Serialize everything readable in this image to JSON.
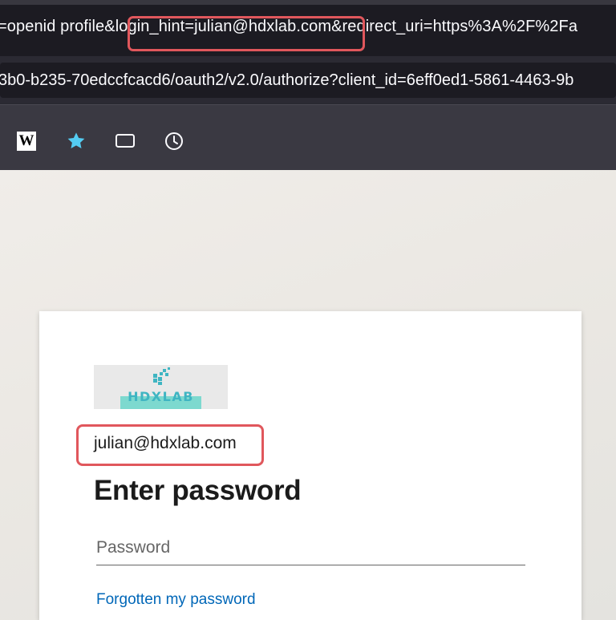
{
  "url_row_1": {
    "before": "=openid profile&",
    "highlight": "login_hint=julian@hdxlab.com",
    "after": "&redirect_uri=https%3A%2F%2Fa"
  },
  "url_row_2": {
    "text": "3b0-b235-70edccfcacd6/oauth2/v2.0/authorize?client_id=6eff0ed1-5861-4463-9b"
  },
  "toolbar": {
    "icons": [
      "wikipedia-icon",
      "star-icon",
      "tab-icon",
      "clock-icon"
    ],
    "wiki_glyph": "W",
    "star_color": "#54ccf2"
  },
  "signin": {
    "logo_text": "HDXLAB",
    "identity": "julian@hdxlab.com",
    "title": "Enter password",
    "password_placeholder": "Password",
    "forgot_link": "Forgotten my password"
  },
  "colors": {
    "highlight_red": "#e0575c",
    "link_blue": "#0067b8",
    "logo_teal": "#3fb5c2"
  }
}
